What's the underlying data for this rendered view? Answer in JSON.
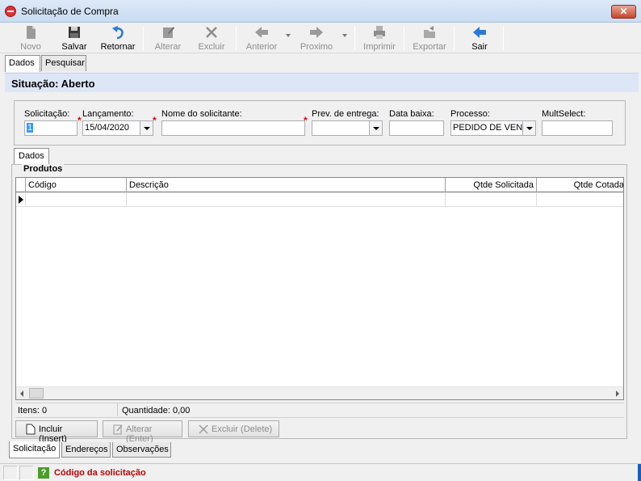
{
  "window": {
    "title": "Solicitação de Compra",
    "close_label": "✕"
  },
  "toolbar": {
    "novo": "Novo",
    "salvar": "Salvar",
    "retornar": "Retornar",
    "alterar": "Alterar",
    "excluir": "Excluir",
    "anterior": "Anterior",
    "proximo": "Proximo",
    "imprimir": "Imprimir",
    "exportar": "Exportar",
    "sair": "Sair"
  },
  "tabs_top": [
    "Dados",
    "Pesquisar"
  ],
  "situacao": "Situação: Aberto",
  "form": {
    "solicitacao_label": "Solicitação:",
    "solicitacao_value": "1",
    "lancamento_label": "Lançamento:",
    "lancamento_value": "15/04/2020",
    "nome_label": "Nome do solicitante:",
    "nome_value": "",
    "prev_label": "Prev. de entrega:",
    "prev_value": "",
    "baixa_label": "Data baixa:",
    "baixa_value": "",
    "processo_label": "Processo:",
    "processo_value": "PEDIDO DE VEN",
    "multselect_label": "MultSelect:",
    "multselect_value": ""
  },
  "sub_tab": "Dados",
  "produtos": {
    "title": "Produtos",
    "columns": [
      "Código",
      "Descrição",
      "Qtde Solicitada",
      "Qtde Cotada"
    ],
    "itens": "Itens: 0",
    "quantidade": "Quantidade: 0,00",
    "incluir": "Incluir (Insert)",
    "alterar": "Alterar (Enter)",
    "excluir": "Excluir (Delete)"
  },
  "tabs_bottom": [
    "Solicitação",
    "Endereços",
    "Observações"
  ],
  "status": {
    "help": "?",
    "message": "Código da solicitação"
  },
  "colors": {
    "accent_blue": "#1a5fb4",
    "situacao_bg": "#dde6f7",
    "status_msg": "#c00000",
    "sair_arrow": "#2a79d6"
  }
}
